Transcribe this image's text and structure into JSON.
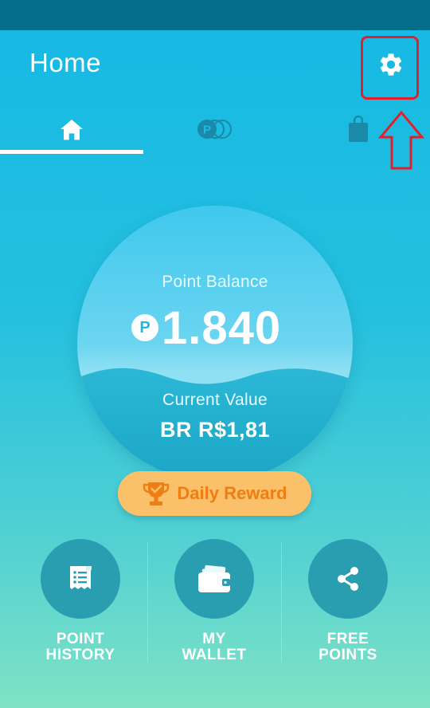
{
  "header": {
    "title": "Home"
  },
  "tabs": [
    {
      "id": "home",
      "icon": "home-icon",
      "active": true
    },
    {
      "id": "points",
      "icon": "points-coins-icon",
      "active": false
    },
    {
      "id": "shop",
      "icon": "shopping-bag-icon",
      "active": false
    }
  ],
  "balance": {
    "label": "Point Balance",
    "symbol": "P",
    "value": "1.840",
    "current_value_label": "Current Value",
    "current_value": "BR R$1,81"
  },
  "daily_reward": {
    "label": "Daily Reward",
    "icon": "trophy-icon"
  },
  "actions": [
    {
      "line1": "POINT",
      "line2": "HISTORY",
      "icon": "receipt-list-icon"
    },
    {
      "line1": "MY",
      "line2": "WALLET",
      "icon": "wallet-icon"
    },
    {
      "line1": "FREE",
      "line2": "POINTS",
      "icon": "share-icon"
    }
  ],
  "colors": {
    "status_bar": "#046e8b",
    "accent": "#15b9e4",
    "highlight": "#e0212c",
    "reward_button": "#fbc06a",
    "reward_text": "#ef7d12",
    "action_circle": "#2a9eb1"
  }
}
